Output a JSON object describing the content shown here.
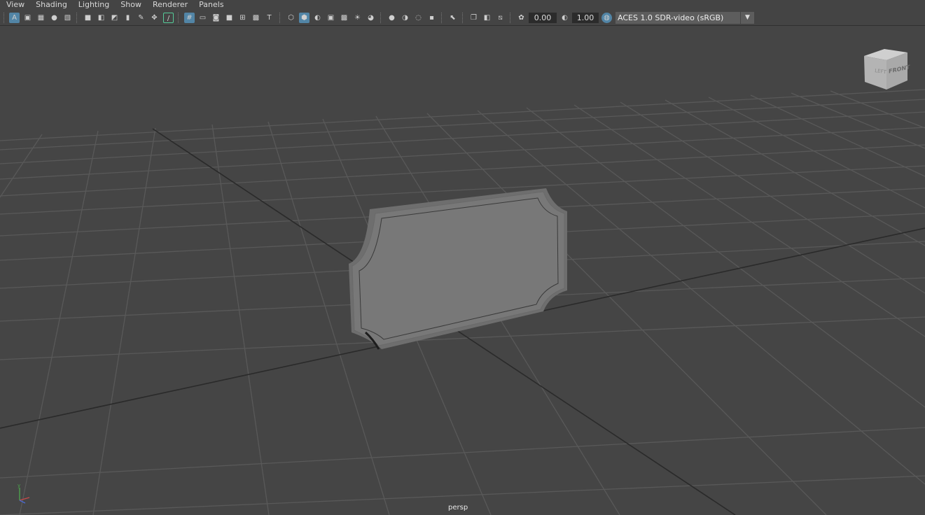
{
  "menu": [
    "View",
    "Shading",
    "Lighting",
    "Show",
    "Renderer",
    "Panels"
  ],
  "toolbar": {
    "exposure_value": "0.00",
    "gamma_value": "1.00",
    "color_space": "ACES 1.0 SDR-video (sRGB)",
    "dropdown_glyph": "▼",
    "icons": [
      "select-camera-icon",
      "camera-attributes-icon",
      "bookmark-icon",
      "image-plane-icon",
      "grid-icon",
      "film-gate-icon",
      "resolution-gate-icon",
      "wireframe-icon",
      "smooth-shade-icon",
      "textured-icon",
      "lighting-icon",
      "shadows-icon",
      "isolate-select-icon",
      "xray-icon",
      "exposure-icon",
      "gamma-icon",
      "color-management-icon"
    ]
  },
  "viewcube": {
    "face_front": "FRONT",
    "face_side": "LEFT"
  },
  "axis": {
    "y_label": "y"
  },
  "camera_label": "persp",
  "colors": {
    "background": "#454545",
    "grid": "#595959",
    "grid_axis": "#2a2a2a",
    "mesh": "#767676",
    "active_icon": "#5285a6"
  }
}
